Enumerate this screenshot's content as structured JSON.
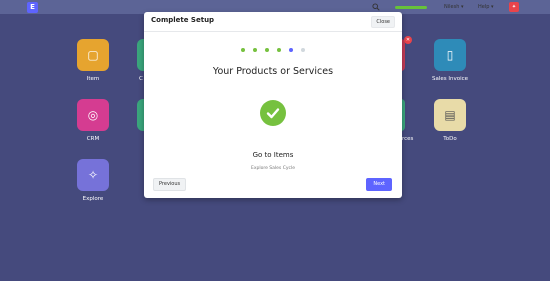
{
  "navbar": {
    "logo_letter": "E",
    "user_label": "Nilesh ▾",
    "help_label": "Help ▾",
    "search_icon": "search-icon"
  },
  "desktop": {
    "apps": [
      {
        "label": "Item",
        "color": "#e6a42f",
        "icon": "box-icon"
      },
      {
        "label": "Sales Invoice",
        "color": "#2e8bb8",
        "icon": "invoice-icon"
      },
      {
        "label": "CRM",
        "color": "#d53c91",
        "icon": "crm-icon"
      },
      {
        "label": "ToDo",
        "color": "#e8dba8",
        "icon": "todo-icon"
      },
      {
        "label": "Explore",
        "color": "#7672d9",
        "icon": "telescope-icon"
      }
    ],
    "partial_label_left": "C",
    "partial_label_right": "rces"
  },
  "modal": {
    "title": "Complete Setup",
    "close_label": "Close",
    "steps": [
      {
        "state": "done",
        "color": "#76c13f"
      },
      {
        "state": "done",
        "color": "#76c13f"
      },
      {
        "state": "done",
        "color": "#76c13f"
      },
      {
        "state": "done",
        "color": "#76c13f"
      },
      {
        "state": "current",
        "color": "#5e64ff"
      },
      {
        "state": "pending",
        "color": "#d1d8dd"
      }
    ],
    "step_title": "Your Products or Services",
    "action_title": "Go to Items",
    "action_subtitle": "Explore Sales Cycle",
    "previous_label": "Previous",
    "next_label": "Next"
  }
}
